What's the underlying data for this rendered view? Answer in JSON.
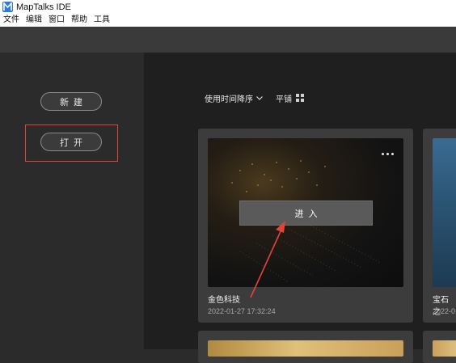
{
  "window": {
    "title": "MapTalks IDE"
  },
  "menu": {
    "items": [
      "文件",
      "编辑",
      "窗口",
      "帮助",
      "工具"
    ]
  },
  "sidebar": {
    "new_label": "新建",
    "open_label": "打开"
  },
  "toolbar": {
    "sort_label": "使用时间降序",
    "view_label": "平铺"
  },
  "cards": [
    {
      "title": "金色科技",
      "date": "2022-01-27 17:32:24",
      "enter_label": "进入"
    },
    {
      "title": "宝石之",
      "date": "2022-0"
    }
  ],
  "colors": {
    "accent_red": "#e0453a",
    "app_blue": "#2f7bd8"
  }
}
